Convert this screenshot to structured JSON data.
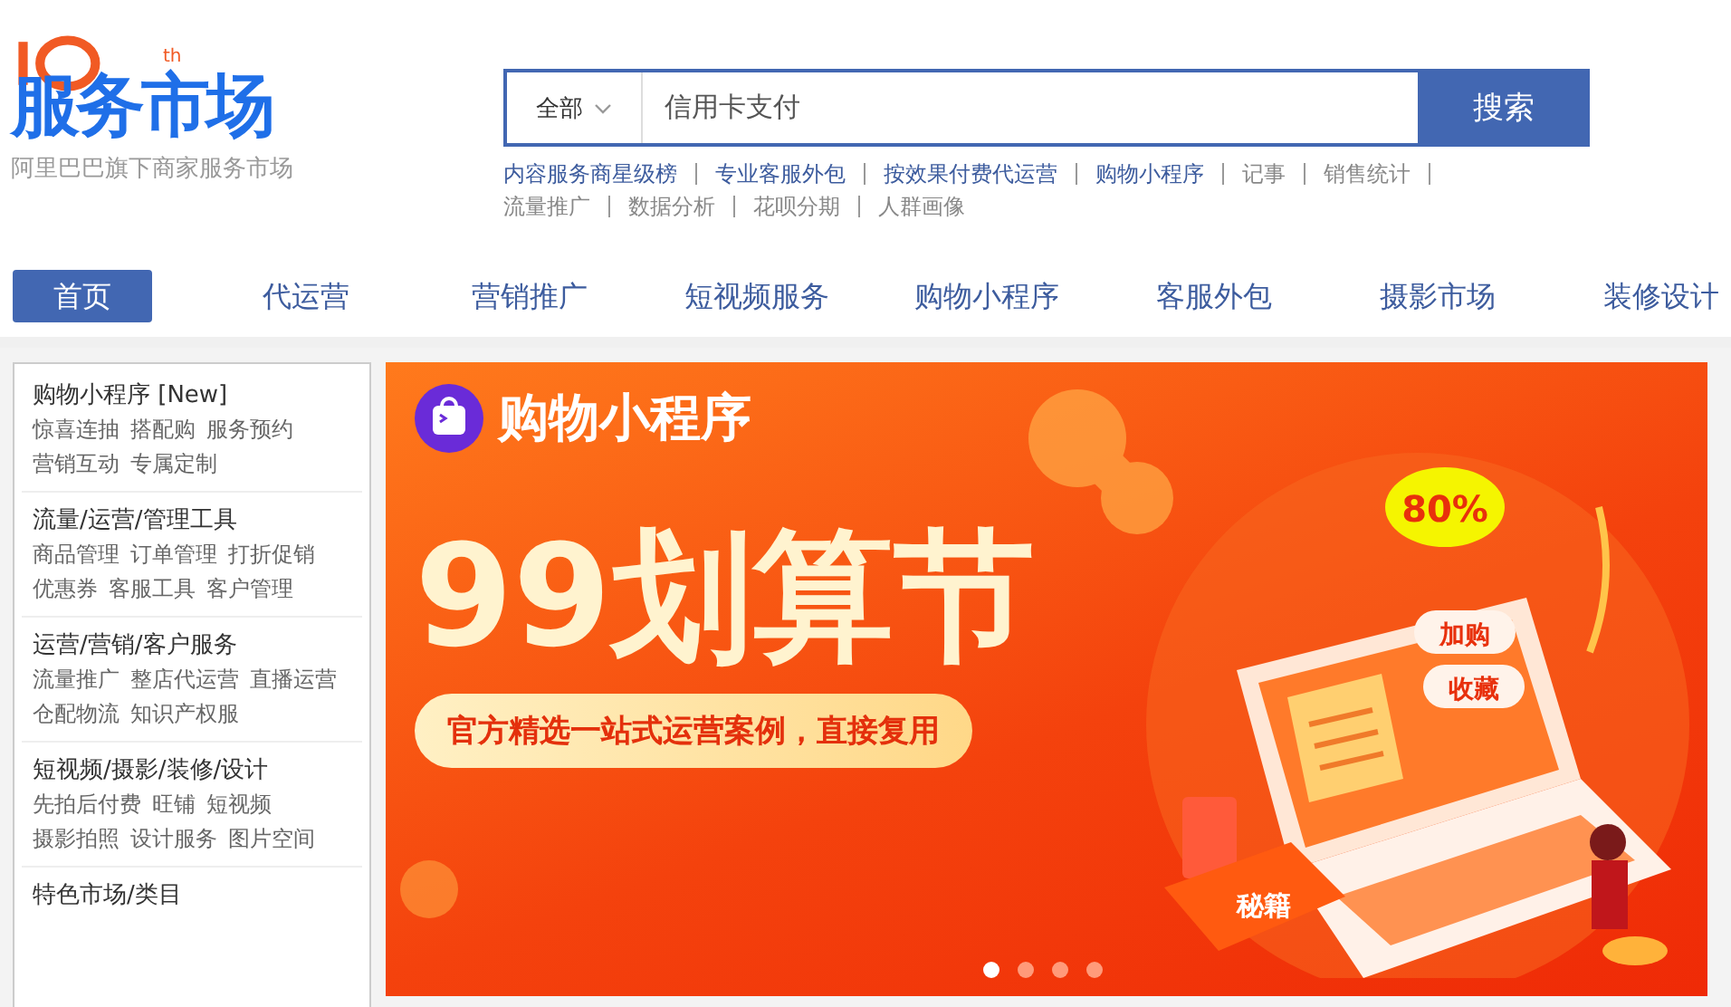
{
  "logo": {
    "title": "服务市场",
    "badge": "th",
    "tagline": "阿里巴巴旗下商家服务市场"
  },
  "search": {
    "scope": "全部",
    "value": "信用卡支付",
    "button": "搜索"
  },
  "hot_links": [
    {
      "label": "内容服务商星级榜",
      "color": "#3d5c9e"
    },
    {
      "label": "专业客服外包",
      "color": "#3d5c9e"
    },
    {
      "label": "按效果付费代运营",
      "color": "#3d5c9e"
    },
    {
      "label": "购物小程序",
      "color": "#3d5c9e"
    },
    {
      "label": "记事",
      "color": "#888888"
    },
    {
      "label": "销售统计",
      "color": "#888888"
    },
    {
      "label": "流量推广",
      "color": "#888888"
    },
    {
      "label": "数据分析",
      "color": "#888888"
    },
    {
      "label": "花呗分期",
      "color": "#888888"
    },
    {
      "label": "人群画像",
      "color": "#888888"
    }
  ],
  "nav": [
    {
      "label": "首页",
      "selected": true
    },
    {
      "label": "代运营",
      "selected": false
    },
    {
      "label": "营销推广",
      "selected": false
    },
    {
      "label": "短视频服务",
      "selected": false
    },
    {
      "label": "购物小程序",
      "selected": false
    },
    {
      "label": "客服外包",
      "selected": false
    },
    {
      "label": "摄影市场",
      "selected": false
    },
    {
      "label": "装修设计",
      "selected": false
    }
  ],
  "sidebar": [
    {
      "title": "购物小程序 [New]",
      "links": [
        "惊喜连抽",
        "搭配购",
        "服务预约",
        "营销互动",
        "专属定制"
      ]
    },
    {
      "title": "流量/运营/管理工具",
      "links": [
        "商品管理",
        "订单管理",
        "打折促销",
        "优惠券",
        "客服工具",
        "客户管理"
      ]
    },
    {
      "title": "运营/营销/客户服务",
      "links": [
        "流量推广",
        "整店代运营",
        "直播运营",
        "仓配物流",
        "知识产权服"
      ]
    },
    {
      "title": "短视频/摄影/装修/设计",
      "links": [
        "先拍后付费",
        "旺铺",
        "短视频",
        "摄影拍照",
        "设计服务",
        "图片空间"
      ]
    },
    {
      "title": "特色市场/类目"
    }
  ],
  "banner": {
    "brand": "购物小程序",
    "headline": "99划算节",
    "subtitle": "官方精选一站式运营案例，直接复用",
    "discount": "80%",
    "cart_tag": "加购",
    "fav_tag": "收藏",
    "book_label": "秘籍",
    "dots": [
      {
        "selected": true
      },
      {
        "selected": false
      },
      {
        "selected": false
      },
      {
        "selected": false
      }
    ]
  }
}
